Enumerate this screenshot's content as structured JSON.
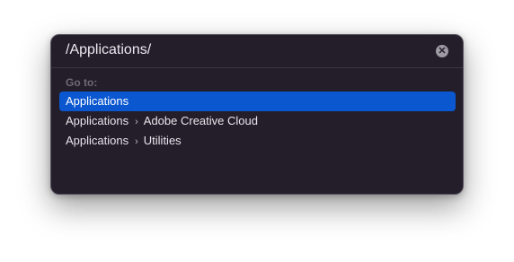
{
  "goto_dialog": {
    "path_value": "/Applications/",
    "clear_icon": "clear-circle-x-icon",
    "section_label": "Go to:",
    "results": [
      {
        "parts": [
          "Applications"
        ],
        "selected": true
      },
      {
        "parts": [
          "Applications",
          "Adobe Creative Cloud"
        ],
        "selected": false
      },
      {
        "parts": [
          "Applications",
          "Utilities"
        ],
        "selected": false
      }
    ],
    "path_separator_icon": "chevron-right-icon",
    "colors": {
      "panel_bg": "#231e2a",
      "selection": "#0b57d0",
      "muted_text": "#6f6a75"
    }
  }
}
